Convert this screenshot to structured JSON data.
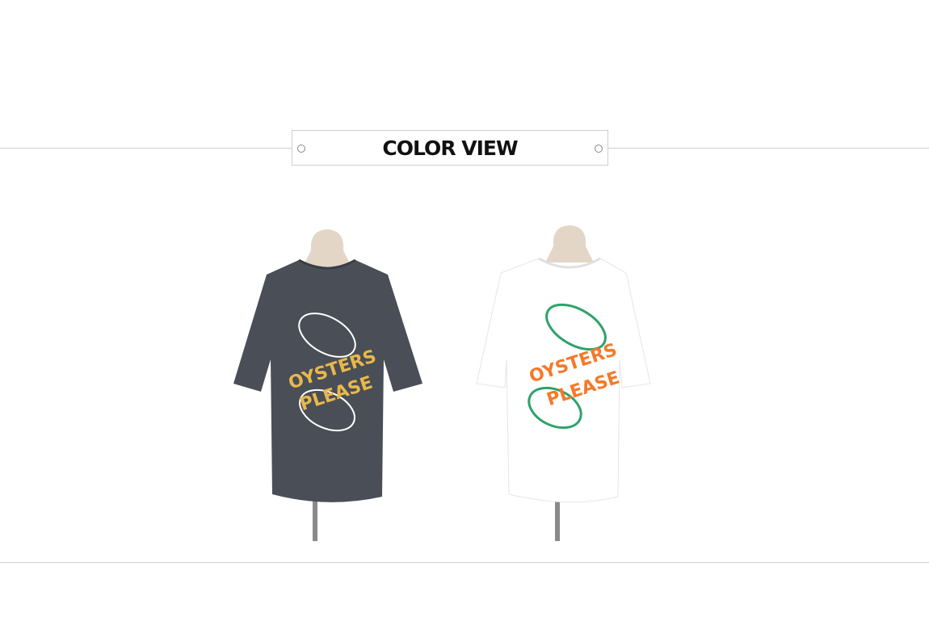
{
  "section_title": "COLOR VIEW",
  "colors": {
    "divider": "#cfcfcf",
    "title_text": "#111111",
    "mannequin": "#e4d6c6",
    "stand": "#8a8a8a"
  },
  "products": [
    {
      "name": "charcoal",
      "shirt_color": "#4a4e56",
      "text_color": "#e7b84c",
      "shell_color": "#ffffff",
      "print_text": [
        "OYSTERS",
        "PLEASE"
      ]
    },
    {
      "name": "white",
      "shirt_color": "#ffffff",
      "text_color": "#f47a2a",
      "shell_color": "#2ea36a",
      "print_text": [
        "OYSTERS",
        "PLEASE"
      ]
    }
  ]
}
